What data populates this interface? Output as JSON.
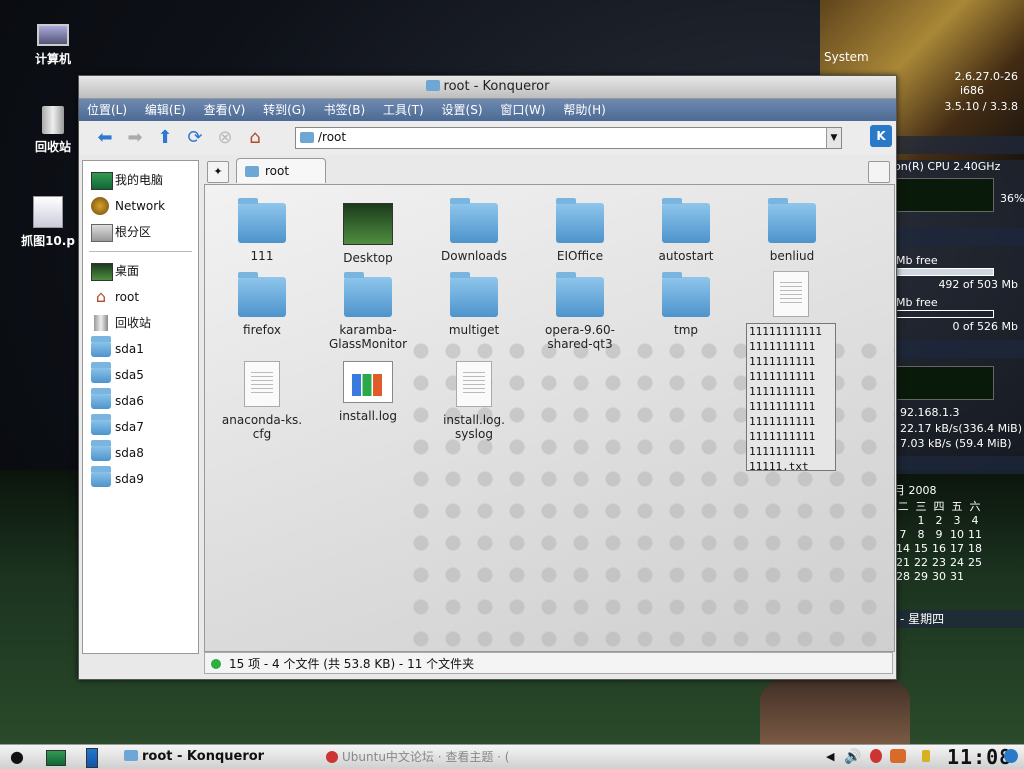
{
  "desktop": {
    "icons": [
      {
        "label": "计算机"
      },
      {
        "label": "回收站"
      },
      {
        "label": "抓图10.p"
      }
    ]
  },
  "sysmon": {
    "title": "System",
    "kernel": "2.6.27.0-26",
    "arch": "i686",
    "kde": "3.5.10 /  3.3.8",
    "cpu_name": "on(R) CPU 2.40GHz",
    "cpu_pct": "36%",
    "mem_label": "Mb free",
    "mem_value": "492 of 503 Mb",
    "swap_label": "Mb free",
    "swap_value": "0 of 526 Mb",
    "ip": "92.168.1.3",
    "down": "22.17 kB/s(336.4 MiB)",
    "up": "7.03 kB/s (59.4 MiB)",
    "cal_header": "月  2008",
    "cal_days": [
      "二",
      "三",
      "四",
      "五",
      "六"
    ],
    "cal_rows": [
      [
        "",
        "1",
        "2",
        "3",
        "4"
      ],
      [
        "7",
        "8",
        "9",
        "10",
        "11"
      ],
      [
        "14",
        "15",
        "16",
        "17",
        "18"
      ],
      [
        "21",
        "22",
        "23",
        "24",
        "25"
      ],
      [
        "28",
        "29",
        "30",
        "31",
        ""
      ]
    ],
    "weekday": "- 星期四"
  },
  "window": {
    "title": "root - Konqueror",
    "menu": [
      "位置(L)",
      "编辑(E)",
      "查看(V)",
      "转到(G)",
      "书签(B)",
      "工具(T)",
      "设置(S)",
      "窗口(W)",
      "帮助(H)"
    ],
    "url": "/root",
    "tab_label": "root",
    "sidebar": [
      {
        "label": "我的电脑"
      },
      {
        "label": "Network"
      },
      {
        "label": "根分区"
      },
      {
        "label": "桌面"
      },
      {
        "label": "root"
      },
      {
        "label": "回收站"
      },
      {
        "label": "sda1"
      },
      {
        "label": "sda5"
      },
      {
        "label": "sda6"
      },
      {
        "label": "sda7"
      },
      {
        "label": "sda8"
      },
      {
        "label": "sda9"
      }
    ],
    "files": [
      {
        "name": "111",
        "kind": "folder"
      },
      {
        "name": "Desktop",
        "kind": "desktop"
      },
      {
        "name": "Downloads",
        "kind": "folder"
      },
      {
        "name": "EIOffice",
        "kind": "folder"
      },
      {
        "name": "autostart",
        "kind": "folder"
      },
      {
        "name": "benliud",
        "kind": "folder"
      },
      {
        "name": "firefox",
        "kind": "folder"
      },
      {
        "name": "karamba-\nGlassMonitor",
        "kind": "folder"
      },
      {
        "name": "multiget",
        "kind": "folder"
      },
      {
        "name": "opera-9.60-\nshared-qt3",
        "kind": "folder"
      },
      {
        "name": "tmp",
        "kind": "folder"
      },
      {
        "name": "anaconda-ks.\ncfg",
        "kind": "doc"
      },
      {
        "name": "install.log",
        "kind": "log"
      },
      {
        "name": "install.log.\nsyslog",
        "kind": "doc"
      }
    ],
    "long_file_name": "11111111111\n1111111111\n1111111111\n1111111111\n1111111111\n1111111111\n1111111111\n1111111111\n1111111111\n11111.txt",
    "status": "15 项 - 4 个文件 (共 53.8 KB) - 11 个文件夹"
  },
  "taskbar": {
    "task_label": "root - Konqueror",
    "task2_label": "Ubuntu中文论坛 · 查看主题 · (",
    "clock": "11:08"
  }
}
